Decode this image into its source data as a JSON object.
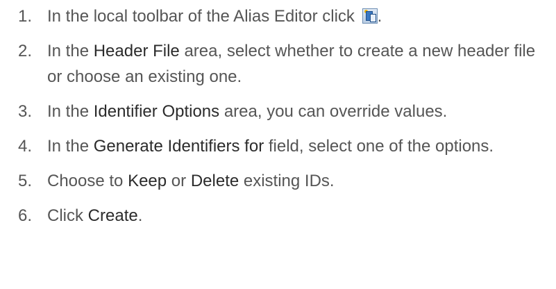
{
  "steps": [
    {
      "num": "1.",
      "parts": {
        "a": "In the local toolbar of the Alias Editor click ",
        "icon": "generate-header-file-icon",
        "b": "."
      }
    },
    {
      "num": "2.",
      "parts": {
        "a": "In the ",
        "term": "Header File",
        "b": " area, select whether to create a new header file or choose an existing one."
      }
    },
    {
      "num": "3.",
      "parts": {
        "a": "In the ",
        "term": "Identifier Options",
        "b": " area, you can override values."
      }
    },
    {
      "num": "4.",
      "parts": {
        "a": "In the ",
        "term": "Generate Identifiers for",
        "b": " field, select one of the options."
      }
    },
    {
      "num": "5.",
      "parts": {
        "a": "Choose to ",
        "term1": "Keep",
        "mid": " or ",
        "term2": "Delete",
        "b": " existing IDs."
      }
    },
    {
      "num": "6.",
      "parts": {
        "a": "Click ",
        "term": "Create",
        "b": "."
      }
    }
  ]
}
